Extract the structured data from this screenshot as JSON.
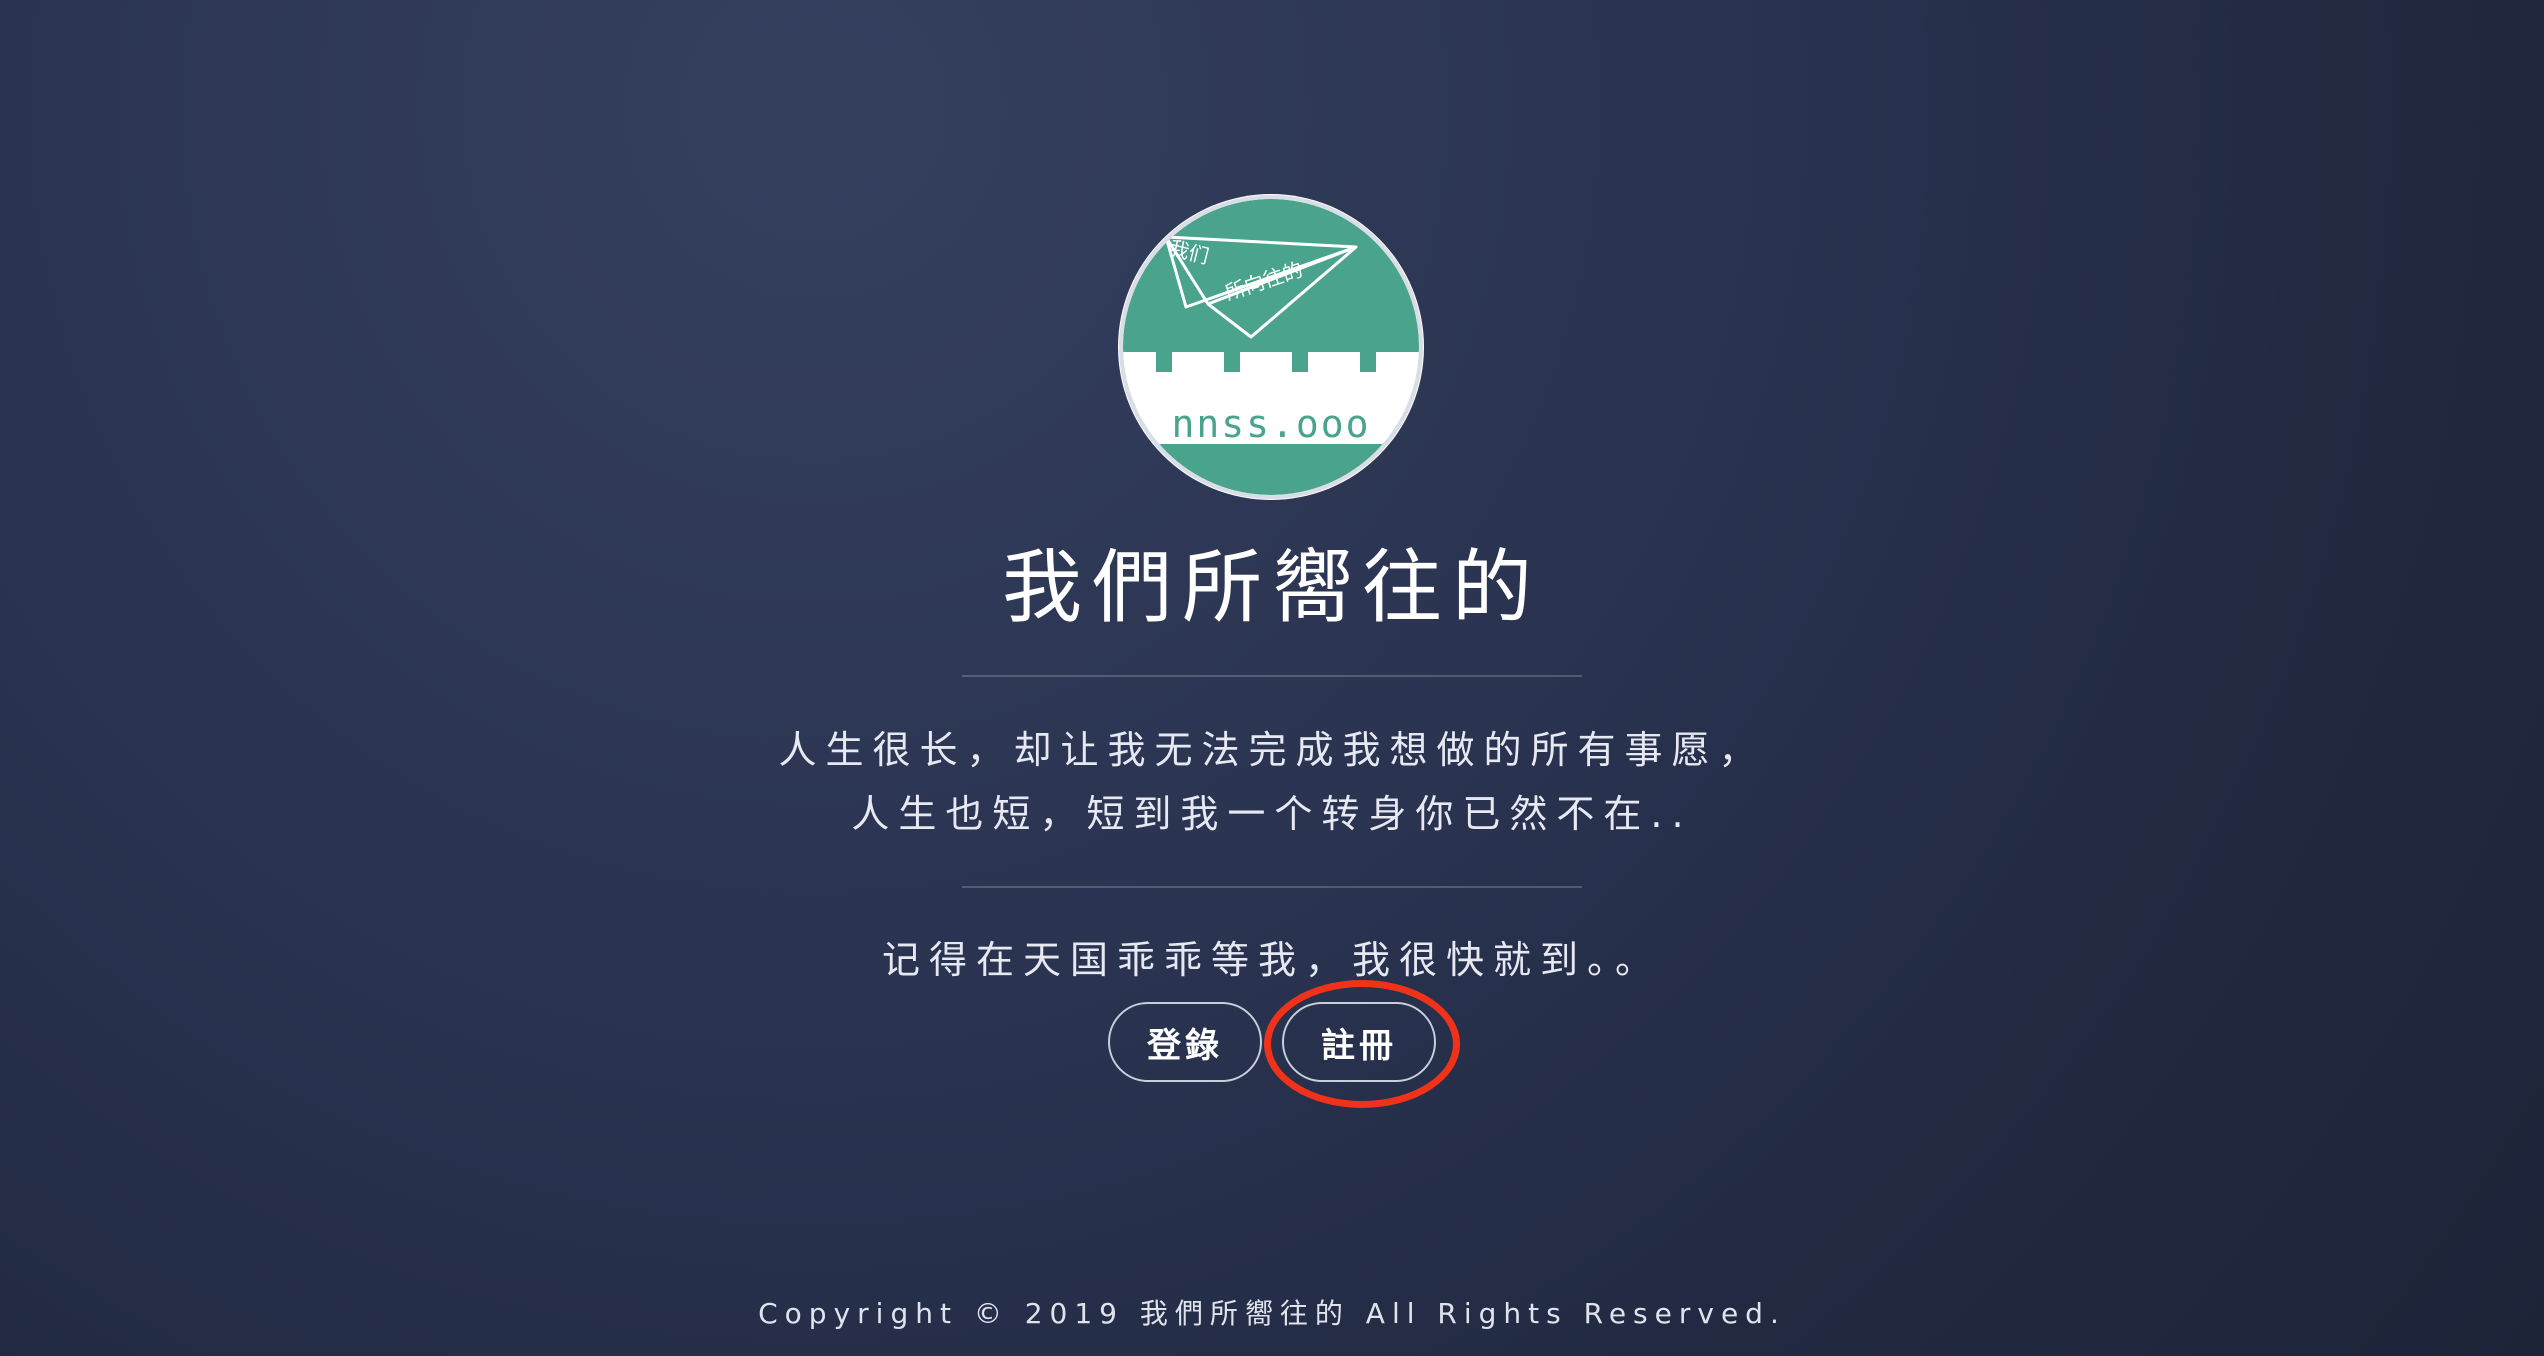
{
  "logo": {
    "line1": "我们",
    "line2": "所向往的",
    "domain": "nnss.ooo",
    "accent_color": "#4aa38d"
  },
  "site_title": "我們所嚮往的",
  "quote": {
    "line1": "人生很长，却让我无法完成我想做的所有事愿，",
    "line2": "人生也短，短到我一个转身你已然不在..",
    "line3": "记得在天国乖乖等我，我很快就到。。"
  },
  "buttons": {
    "login_label": "登錄",
    "register_label": "註冊"
  },
  "highlight": {
    "target": "register-button",
    "color": "#f0321a"
  },
  "footer": {
    "copyright": "Copyright © 2019 我們所嚮往的 All Rights Reserved."
  }
}
